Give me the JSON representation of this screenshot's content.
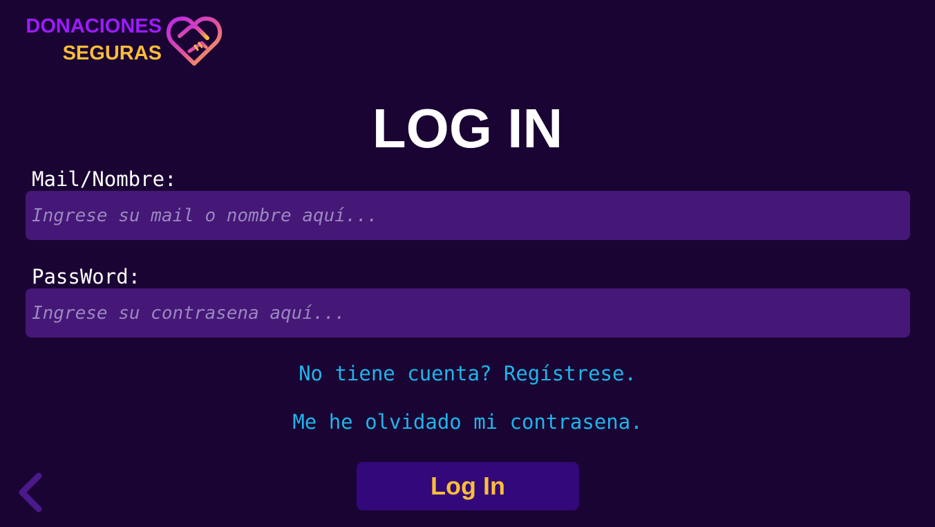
{
  "brand": {
    "line1": "DONACIONES",
    "line2": "SEGURAS",
    "icon": "heart-handshake-icon",
    "colors": {
      "primary": "#9d1cff",
      "secondary": "#fbbd3a",
      "gradient_start": "#b928e8",
      "gradient_end": "#fbbd3a"
    }
  },
  "page": {
    "title": "LOG IN",
    "background": "#1a0433"
  },
  "form": {
    "username": {
      "label": "Mail/Nombre:",
      "placeholder": "Ingrese su mail o nombre aquí...",
      "value": ""
    },
    "password": {
      "label": "PassWord:",
      "placeholder": "Ingrese su contrasena aquí...",
      "value": ""
    },
    "input_background": "#451777"
  },
  "links": {
    "register": "No tiene cuenta? Regístrese.",
    "forgot_password": "Me he olvidado mi contrasena.",
    "color": "#1fb5ea"
  },
  "actions": {
    "login_label": "Log In",
    "login_bg": "#33087a",
    "login_text_color": "#fbbd3a",
    "back_icon": "chevron-left-icon",
    "back_color": "#4a1a8c"
  }
}
